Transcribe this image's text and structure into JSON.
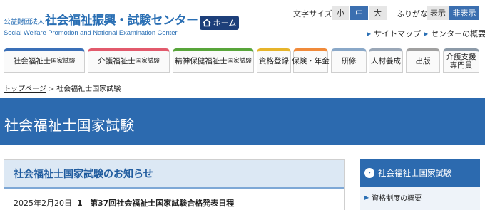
{
  "header": {
    "logo_prefix": "公益財団法人",
    "logo_title": "社会福祉振興・試験センター",
    "logo_subtitle": "Social Welfare Promotion and National Examination Center",
    "home_label": "ホーム",
    "font_size_label": "文字サイズ",
    "font_sizes": [
      "小",
      "中",
      "大"
    ],
    "font_size_selected": "中",
    "furigana_label": "ふりがな",
    "furigana_options": [
      "表示",
      "非表示"
    ],
    "furigana_selected": "非表示",
    "links": [
      "サイトマップ",
      "センターの概要"
    ]
  },
  "nav": {
    "tabs": [
      {
        "label": "社会福祉士",
        "small": "国家試験",
        "color": "#3a6fb7"
      },
      {
        "label": "介護福祉士",
        "small": "国家試験",
        "color": "#e25a6c"
      },
      {
        "label": "精神保健福祉士",
        "small": "国家試験",
        "color": "#58a53a"
      },
      {
        "label": "資格登録",
        "small": "",
        "color": "#e6b42a"
      },
      {
        "label": "保険・年金",
        "small": "",
        "color": "#f08a3a"
      },
      {
        "label": "研修",
        "small": "",
        "color": "#8aa8c8"
      },
      {
        "label": "人材養成",
        "small": "",
        "color": "#9aa7b7"
      },
      {
        "label": "出版",
        "small": "",
        "color": "#a0a0a0"
      },
      {
        "label": "介護支援",
        "label2": "専門員",
        "small": "",
        "color": "#8c9aa8"
      }
    ]
  },
  "breadcrumb": {
    "home": "トップページ",
    "separator": ">",
    "current": "社会福祉士国家試験"
  },
  "page_title": "社会福祉士国家試験",
  "news": {
    "heading": "社会福祉士国家試験のお知らせ",
    "items": [
      {
        "date": "2025年2月20日",
        "num": "1",
        "text": "第37回社会福祉士国家試験合格発表日程"
      }
    ]
  },
  "side": {
    "heading": "社会福祉士国家試験",
    "items": [
      "資格制度の概要"
    ]
  }
}
